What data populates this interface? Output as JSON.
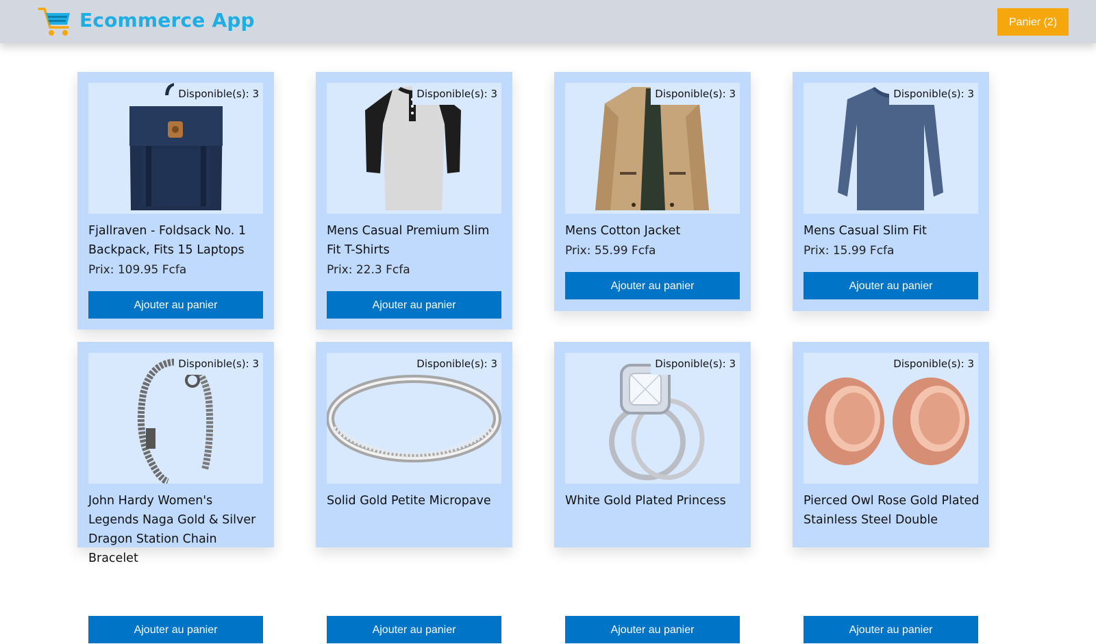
{
  "header": {
    "brand": "Ecommerce App",
    "cart_label": "Panier (2)"
  },
  "products": [
    {
      "title": "Fjallraven - Foldsack No. 1 Backpack, Fits 15 Laptops",
      "price": "Prix: 109.95 Fcfa",
      "stock": "Disponible(s): 3",
      "button": "Ajouter au panier",
      "image": "backpack"
    },
    {
      "title": "Mens Casual Premium Slim Fit T-Shirts",
      "price": "Prix: 22.3 Fcfa",
      "stock": "Disponible(s): 3",
      "button": "Ajouter au panier",
      "image": "tshirt"
    },
    {
      "title": "Mens Cotton Jacket",
      "price": "Prix: 55.99 Fcfa",
      "stock": "Disponible(s): 3",
      "button": "Ajouter au panier",
      "image": "jacket"
    },
    {
      "title": "Mens Casual Slim Fit",
      "price": "Prix: 15.99 Fcfa",
      "stock": "Disponible(s): 3",
      "button": "Ajouter au panier",
      "image": "longsleeve"
    },
    {
      "title": "John Hardy Women's Legends Naga Gold & Silver Dragon Station Chain Bracelet",
      "price": "",
      "stock": "Disponible(s): 3",
      "button": "Ajouter au panier",
      "image": "bracelet"
    },
    {
      "title": "Solid Gold Petite Micropave",
      "price": "",
      "stock": "Disponible(s): 3",
      "button": "Ajouter au panier",
      "image": "ring"
    },
    {
      "title": "White Gold Plated Princess",
      "price": "",
      "stock": "Disponible(s): 3",
      "button": "Ajouter au panier",
      "image": "diamond-ring"
    },
    {
      "title": "Pierced Owl Rose Gold Plated Stainless Steel Double",
      "price": "",
      "stock": "Disponible(s): 3",
      "button": "Ajouter au panier",
      "image": "plugs"
    }
  ],
  "colors": {
    "header_bg": "#d3d8e0",
    "brand": "#1eaee4",
    "cart_button": "#f6a70e",
    "card_bg": "#bfdafc",
    "image_bg": "#d8e9fe",
    "add_button": "#0074c7"
  }
}
